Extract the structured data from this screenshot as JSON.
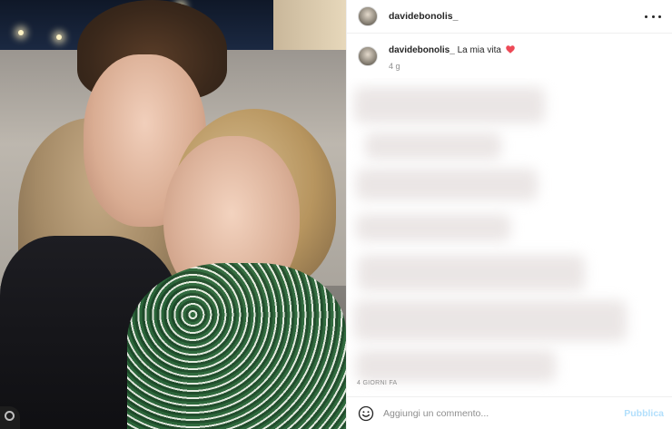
{
  "header": {
    "username": "davidebonolis_",
    "more_icon": "more-horizontal-icon"
  },
  "caption": {
    "username": "davidebonolis_",
    "text": "La mia vita",
    "emoji_icon": "red-heart-icon",
    "heart_color": "#ed4956",
    "time": "4 g"
  },
  "post_meta": {
    "date": "4 giorni fa"
  },
  "comment_box": {
    "emoji_icon": "smiley-face-icon",
    "placeholder": "Aggiungi un commento...",
    "publish_label": "Pubblica",
    "publish_color": "#b2dffc"
  },
  "photo": {
    "nav_icon": "carousel-indicator-icon"
  },
  "colors": {
    "text_primary": "#262626",
    "text_secondary": "#8e8e8e",
    "border": "#efefef"
  }
}
